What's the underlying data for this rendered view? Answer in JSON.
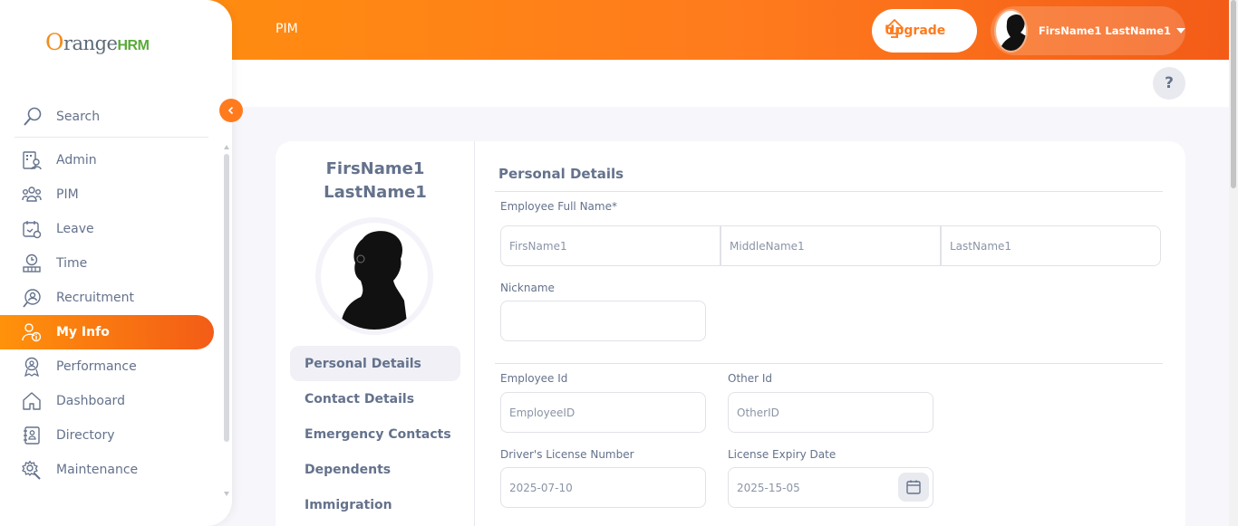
{
  "topbar": {
    "module_title": "PIM",
    "upgrade_label": "Upgrade",
    "user_name": "FirsName1 LastName1"
  },
  "help": {
    "label": "?"
  },
  "sidebar": {
    "brand": {
      "o": "O",
      "range": "range",
      "hrm": "HRM"
    },
    "search_label": "Search",
    "items": [
      {
        "label": "Admin",
        "icon": "admin-icon"
      },
      {
        "label": "PIM",
        "icon": "pim-icon"
      },
      {
        "label": "Leave",
        "icon": "leave-icon"
      },
      {
        "label": "Time",
        "icon": "time-icon"
      },
      {
        "label": "Recruitment",
        "icon": "recruitment-icon"
      },
      {
        "label": "My Info",
        "icon": "my-info-icon",
        "active": true
      },
      {
        "label": "Performance",
        "icon": "performance-icon"
      },
      {
        "label": "Dashboard",
        "icon": "dashboard-icon"
      },
      {
        "label": "Directory",
        "icon": "directory-icon"
      },
      {
        "label": "Maintenance",
        "icon": "maintenance-icon"
      }
    ]
  },
  "profile": {
    "first_name": "FirsName1",
    "last_name": "LastName1",
    "tabs": [
      "Personal Details",
      "Contact Details",
      "Emergency Contacts",
      "Dependents",
      "Immigration"
    ],
    "active_tab": "Personal Details"
  },
  "form": {
    "title": "Personal Details",
    "full_name_label": "Employee Full Name*",
    "first_name_placeholder": "FirsName1",
    "middle_name_placeholder": "MiddleName1",
    "last_name_placeholder": "LastName1",
    "nickname_label": "Nickname",
    "nickname_value": "",
    "employee_id_label": "Employee Id",
    "employee_id_value": "EmployeeID",
    "other_id_label": "Other Id",
    "other_id_value": "OtherID",
    "license_label": "Driver's License Number",
    "license_value": "2025-07-10",
    "expiry_label": "License Expiry Date",
    "expiry_value": "2025-15-05"
  },
  "colors": {
    "accent": "#ff7b1d",
    "accent_dark": "#f35c17",
    "text": "#64728c"
  }
}
